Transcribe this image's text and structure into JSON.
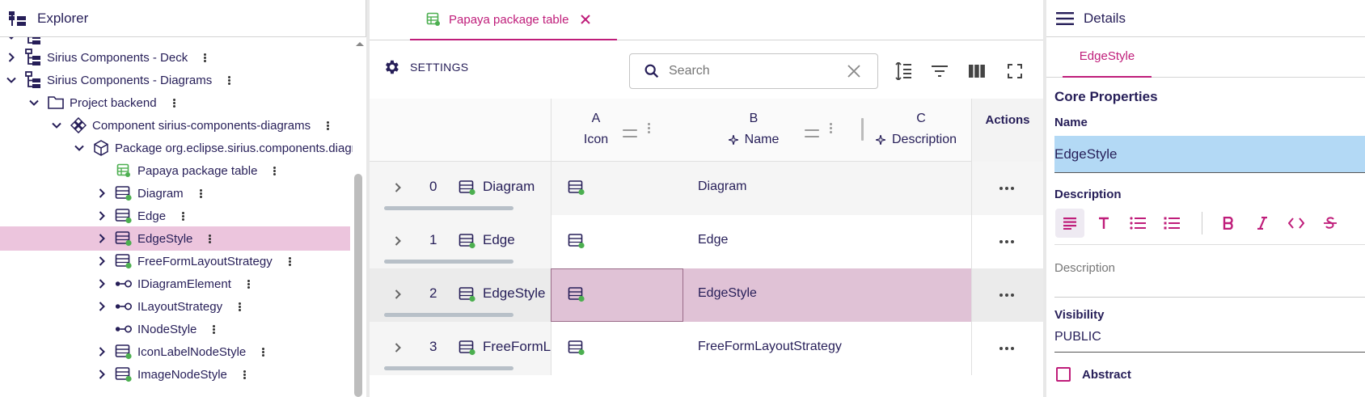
{
  "explorer": {
    "title": "Explorer",
    "rows": [
      {
        "label": "",
        "depth": 0,
        "expand": "down",
        "icon": "project-icon"
      },
      {
        "label": "Sirius Components - Deck",
        "depth": 0,
        "expand": "right",
        "icon": "project-icon"
      },
      {
        "label": "Sirius Components - Diagrams",
        "depth": 0,
        "expand": "down",
        "icon": "project-icon"
      },
      {
        "label": "Project backend",
        "depth": 1,
        "expand": "down",
        "icon": "folder-icon"
      },
      {
        "label": "Component sirius-components-diagrams",
        "depth": 2,
        "expand": "down",
        "icon": "component-icon"
      },
      {
        "label": "Package org.eclipse.sirius.components.diagrams",
        "depth": 3,
        "expand": "down",
        "icon": "package-icon"
      },
      {
        "label": "Papaya package table",
        "depth": 4,
        "expand": "none",
        "icon": "table-icon"
      },
      {
        "label": "Diagram",
        "depth": 4,
        "expand": "right",
        "icon": "class-icon"
      },
      {
        "label": "Edge",
        "depth": 4,
        "expand": "right",
        "icon": "class-icon"
      },
      {
        "label": "EdgeStyle",
        "depth": 4,
        "expand": "right",
        "icon": "class-icon",
        "selected": true
      },
      {
        "label": "FreeFormLayoutStrategy",
        "depth": 4,
        "expand": "right",
        "icon": "class-icon"
      },
      {
        "label": "IDiagramElement",
        "depth": 4,
        "expand": "right",
        "icon": "interface-icon"
      },
      {
        "label": "ILayoutStrategy",
        "depth": 4,
        "expand": "right",
        "icon": "interface-icon"
      },
      {
        "label": "INodeStyle",
        "depth": 4,
        "expand": "none",
        "icon": "interface-icon"
      },
      {
        "label": "IconLabelNodeStyle",
        "depth": 4,
        "expand": "right",
        "icon": "class-icon"
      },
      {
        "label": "ImageNodeStyle",
        "depth": 4,
        "expand": "right",
        "icon": "class-icon"
      }
    ]
  },
  "editor": {
    "tab_label": "Papaya package table",
    "settings_label": "SETTINGS",
    "search_placeholder": "Search",
    "columns": {
      "a": {
        "letter": "A",
        "name": "Icon"
      },
      "b": {
        "letter": "B",
        "name": "Name"
      },
      "c": {
        "letter": "C",
        "name": "Description"
      },
      "actions": "Actions"
    },
    "rows": [
      {
        "index": "0",
        "name": "Diagram",
        "cell_name": "Diagram"
      },
      {
        "index": "1",
        "name": "Edge",
        "cell_name": "Edge"
      },
      {
        "index": "2",
        "name": "EdgeStyle",
        "cell_name": "EdgeStyle",
        "selected": true
      },
      {
        "index": "3",
        "name": "FreeFormLayoutStrategy",
        "cell_name": "FreeFormLayoutStrategy"
      }
    ]
  },
  "details": {
    "title": "Details",
    "tab_label": "EdgeStyle",
    "section_title": "Core Properties",
    "name_label": "Name",
    "name_value": "EdgeStyle",
    "description_label": "Description",
    "description_placeholder": "Description",
    "visibility_label": "Visibility",
    "visibility_value": "PUBLIC",
    "abstract_label": "Abstract"
  },
  "colors": {
    "accent": "#bf1d7a",
    "text": "#261e58",
    "selection": "#ecc5dd",
    "name_field": "#b3d9f5"
  }
}
